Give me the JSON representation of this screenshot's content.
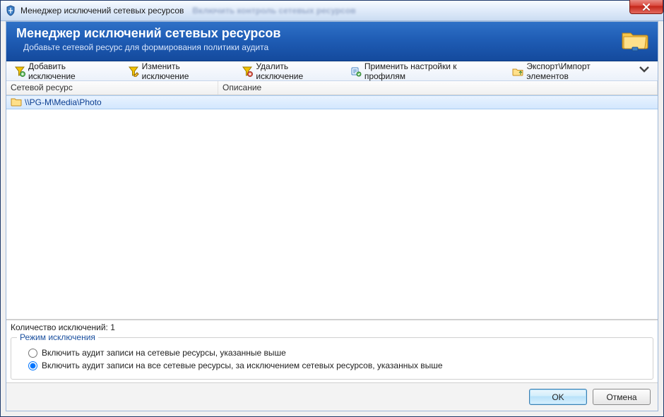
{
  "window": {
    "title": "Менеджер исключений сетевых ресурсов",
    "blurred_secondary_title": "Включить контроль сетевых ресурсов"
  },
  "banner": {
    "title": "Менеджер исключений сетевых ресурсов",
    "subtitle": "Добавьте сетевой ресурс для формирования политики аудита"
  },
  "toolbar": {
    "add_label": "Добавить исключение",
    "edit_label": "Изменить исключение",
    "delete_label": "Удалить исключение",
    "apply_label": "Применить настройки к профилям",
    "export_label": "Экспорт\\Импорт элементов"
  },
  "grid": {
    "col_resource": "Сетевой ресурс",
    "col_description": "Описание",
    "rows": [
      {
        "resource": "\\\\PG-M\\Media\\Photo",
        "description": ""
      }
    ]
  },
  "count_label": "Количество исключений: 1",
  "group": {
    "legend": "Режим исключения",
    "radio1": "Включить аудит записи на сетевые ресурсы, указанные выше",
    "radio2": "Включить аудит записи на все сетевые ресурсы, за исключением сетевых ресурсов, указанных выше",
    "selected": 2
  },
  "footer": {
    "ok": "OK",
    "cancel": "Отмена"
  }
}
